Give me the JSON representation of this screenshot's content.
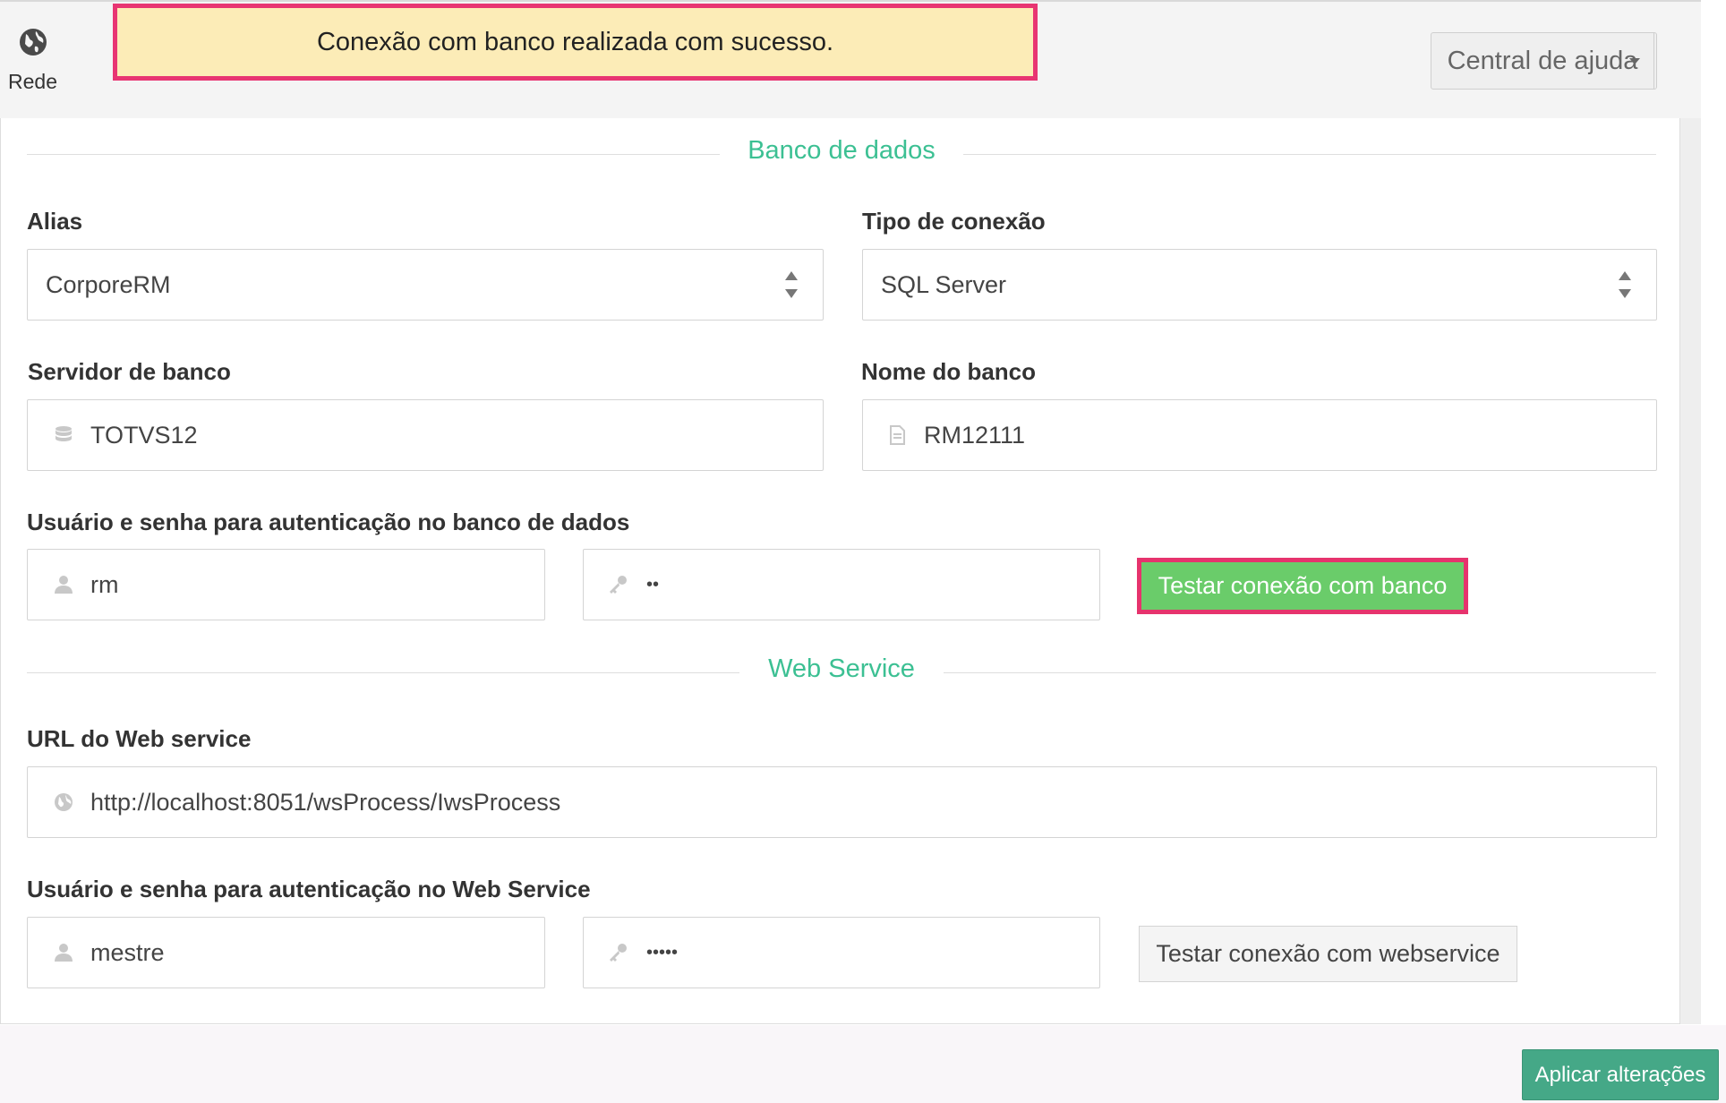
{
  "topbar": {
    "rede_label": "Rede",
    "toast_message": "Conexão com banco realizada com sucesso.",
    "help_button_label": "Central de ajuda"
  },
  "database_section": {
    "title": "Banco de dados",
    "alias": {
      "label": "Alias",
      "value": "CorporeRM"
    },
    "connection_type": {
      "label": "Tipo de conexão",
      "value": "SQL Server"
    },
    "server": {
      "label": "Servidor de banco",
      "value": "TOTVS12"
    },
    "db_name": {
      "label": "Nome do banco",
      "value": "RM12111"
    },
    "auth_label": "Usuário e senha para autenticação no banco de dados",
    "user_value": "rm",
    "password_value": "••",
    "test_button_label": "Testar conexão com banco"
  },
  "webservice_section": {
    "title": "Web Service",
    "url": {
      "label": "URL do Web service",
      "value": "http://localhost:8051/wsProcess/IwsProcess"
    },
    "auth_label": "Usuário e senha para autenticação no Web Service",
    "user_value": "mestre",
    "password_value": "•••••",
    "test_button_label": "Testar conexão com webservice"
  },
  "footer": {
    "apply_button_label": "Aplicar alterações"
  },
  "colors": {
    "accent_green": "#3cc093",
    "highlight_pink": "#e83572",
    "toast_bg": "#fcecb7",
    "test_button_green": "#6acc6a",
    "apply_button": "#45a887"
  }
}
